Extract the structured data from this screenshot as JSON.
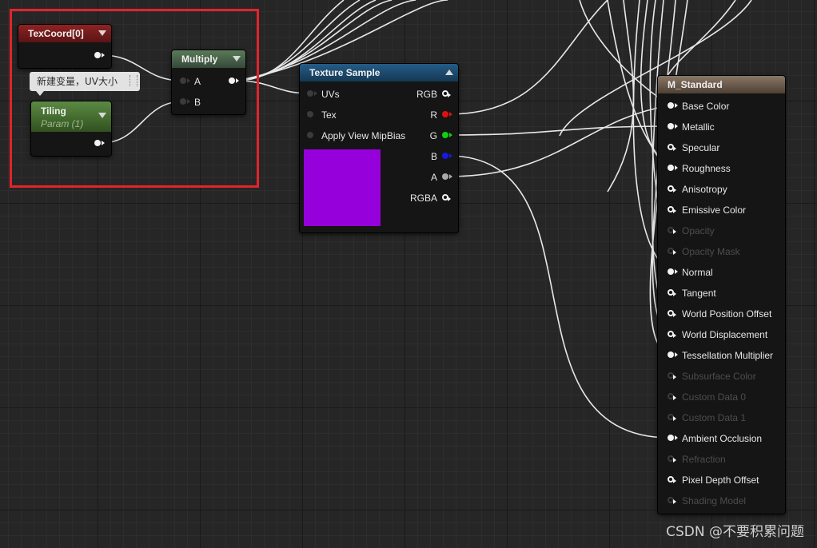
{
  "nodes": {
    "texcoord": {
      "title": "TexCoord[0]"
    },
    "multiply": {
      "title": "Multiply",
      "input_a": "A",
      "input_b": "B"
    },
    "tiling": {
      "title": "Tiling",
      "subtitle": "Param (1)"
    },
    "texture_sample": {
      "title": "Texture Sample",
      "inputs": [
        "UVs",
        "Tex",
        "Apply View MipBias"
      ],
      "outputs": [
        "RGB",
        "R",
        "G",
        "B",
        "A",
        "RGBA"
      ],
      "preview_color": "#9600db"
    },
    "m_standard": {
      "title": "M_Standard",
      "inputs": [
        "Base Color",
        "Metallic",
        "Specular",
        "Roughness",
        "Anisotropy",
        "Emissive Color",
        "Opacity",
        "Opacity Mask",
        "Normal",
        "Tangent",
        "World Position Offset",
        "World Displacement",
        "Tessellation Multiplier",
        "Subsurface Color",
        "Custom Data 0",
        "Custom Data 1",
        "Ambient Occlusion",
        "Refraction",
        "Pixel Depth Offset",
        "Shading Model"
      ]
    }
  },
  "comment_bubble": "新建变量，UV大小",
  "watermark": "CSDN @不要积累问题",
  "colors": {
    "highlight": "#e3232d",
    "texcoord_header": "#8e2323",
    "multiply_header": "#5a7a58",
    "tiling_header": "#5b8a43",
    "texture_header": "#245c86",
    "material_header": "#8a7766",
    "pin_r": "#e01111",
    "pin_g": "#12d012",
    "pin_b": "#1818e6"
  }
}
